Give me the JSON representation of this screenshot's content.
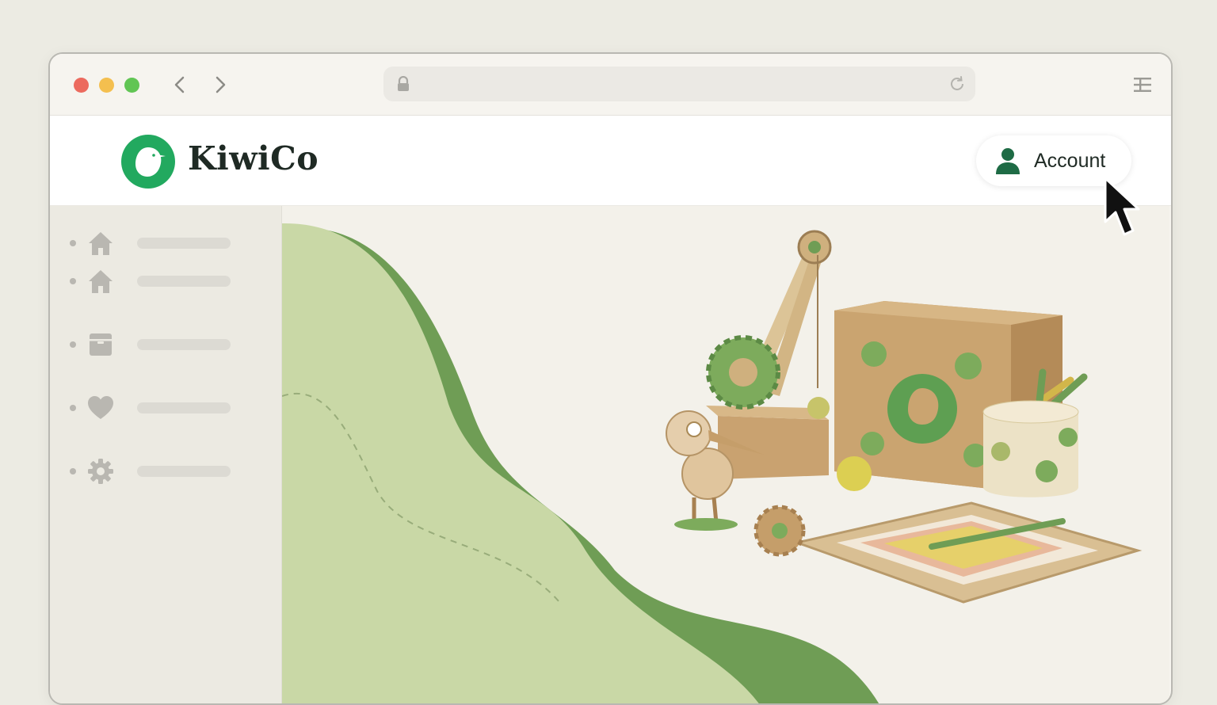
{
  "brand": {
    "name": "KiwiCo",
    "color": "#22a95f"
  },
  "header": {
    "account_label": "Account"
  },
  "browser": {
    "traffic_lights": [
      "#ec6a5e",
      "#f4bf4f",
      "#61c554"
    ],
    "address_value": ""
  },
  "sidebar": {
    "items": [
      {
        "icon": "home-icon"
      },
      {
        "icon": "home-icon"
      },
      {
        "icon": "box-icon"
      },
      {
        "icon": "heart-icon"
      },
      {
        "icon": "gear-icon"
      }
    ]
  },
  "colors": {
    "wave_light": "#c9d8a6",
    "wave_dark": "#6f9d55",
    "text_dark": "#1f2a24"
  }
}
